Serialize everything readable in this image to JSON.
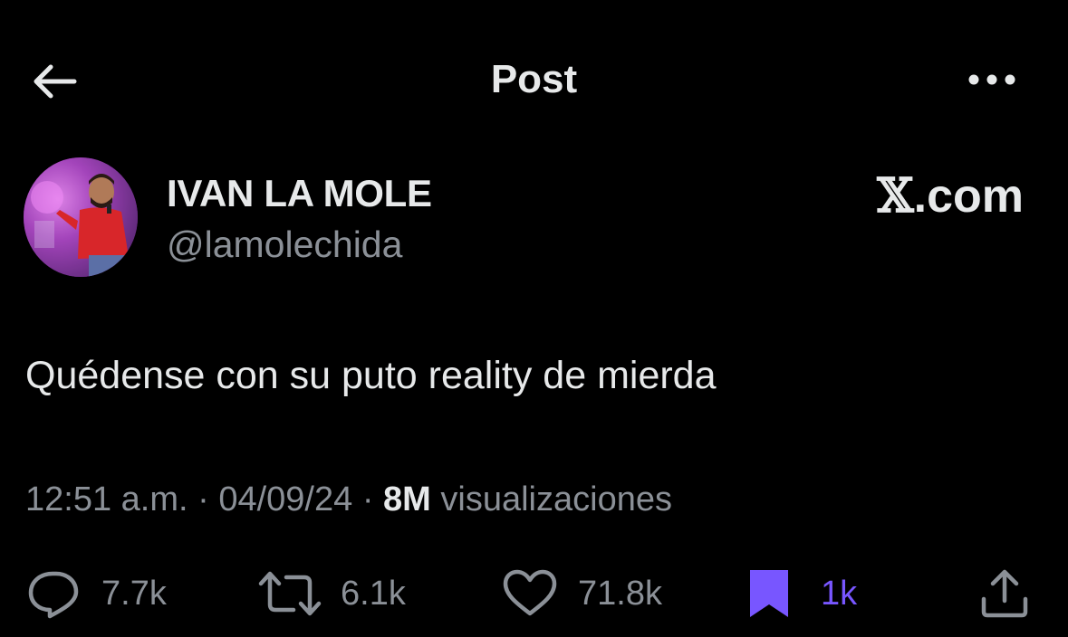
{
  "header": {
    "title": "Post",
    "back_icon": "arrow-left-icon",
    "more_icon": "more-horizontal-icon"
  },
  "author": {
    "display_name": "IVAN LA MOLE",
    "handle": "@lamolechida"
  },
  "brand": {
    "x_letter": "𝕏",
    "suffix": ".com"
  },
  "post": {
    "text": "Quédense con su puto reality de mierda"
  },
  "meta": {
    "time": "12:51 a.m.",
    "separator": "·",
    "date": "04/09/24",
    "views_count": "8M",
    "views_label": "visualizaciones"
  },
  "actions": {
    "replies": "7.7k",
    "reposts": "6.1k",
    "likes": "71.8k",
    "bookmarks": "1k"
  },
  "colors": {
    "background": "#000000",
    "primary_text": "#e7e9ea",
    "secondary_text": "#8b9097",
    "bookmark_accent": "#7856ff"
  }
}
